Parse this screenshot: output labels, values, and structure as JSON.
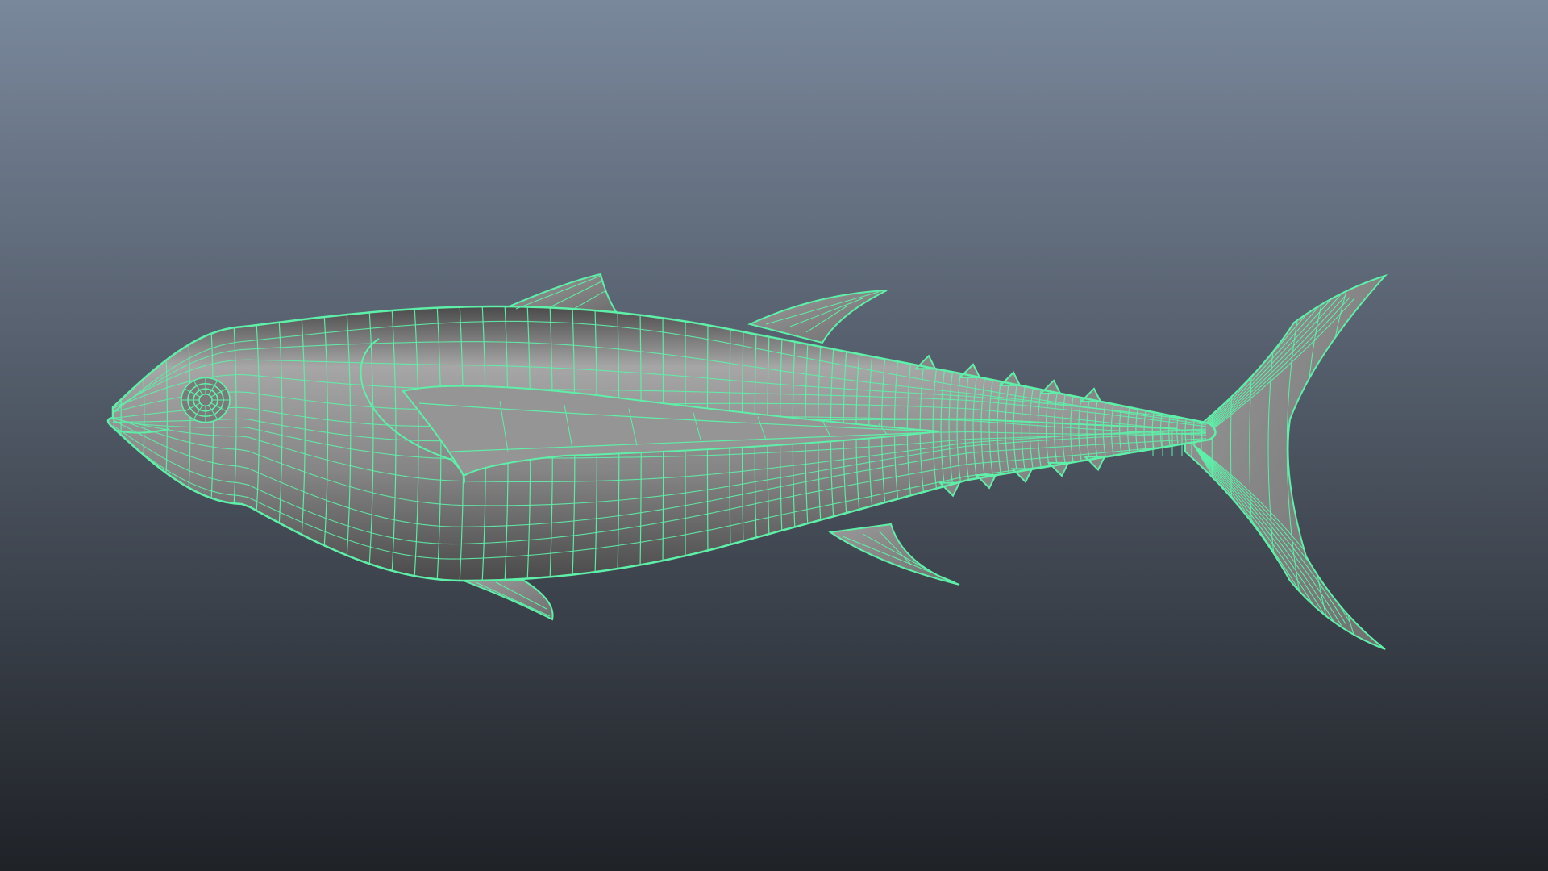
{
  "viewport": {
    "background_top": "#7a889c",
    "background_bottom": "#1f2227",
    "shade_view": "smooth-shaded-with-wireframe"
  },
  "model": {
    "object": "tuna-fish-mesh",
    "selected": true,
    "wireframe_color": "#5ef0a8",
    "surface_light": "#a6a6a6",
    "surface_mid": "#858585",
    "surface_dark": "#4a4a4a"
  }
}
